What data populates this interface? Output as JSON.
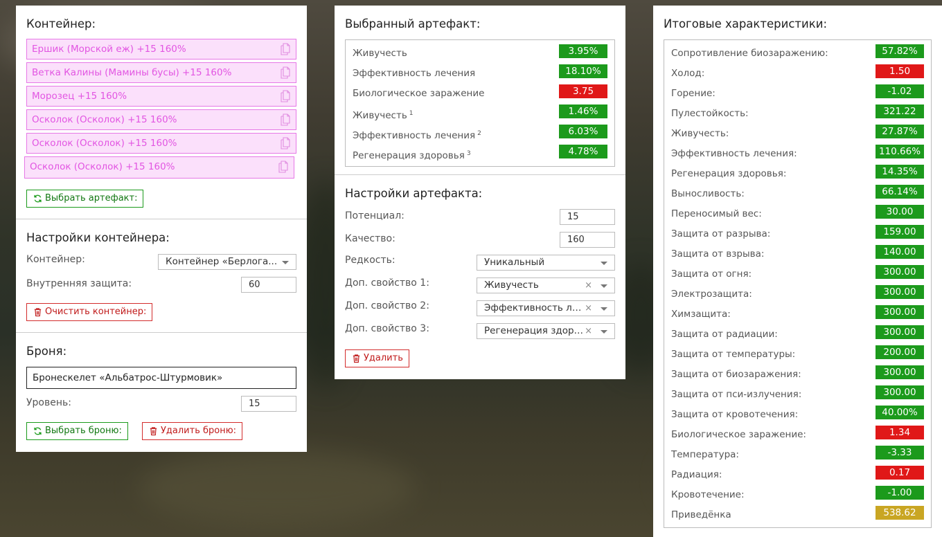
{
  "colors": {
    "green": "#1c9a1c",
    "red": "#e01818",
    "gold": "#c9a623",
    "pink": "#e255e2"
  },
  "container_panel": {
    "title": "Контейнер:",
    "items": [
      "Ершик (Морской еж) +15 160%",
      "Ветка Калины (Мамины бусы) +15 160%",
      "Морозец +15 160%",
      "Осколок (Осколок) +15 160%",
      "Осколок (Осколок) +15 160%",
      "Осколок (Осколок) +15 160%"
    ],
    "item_icon": "copy-document-icon",
    "choose_artifact_button": "Выбрать артефакт:",
    "settings_title": "Настройки контейнера:",
    "container_label": "Контейнер:",
    "container_value": "Контейнер «Берлога...",
    "inner_protection_label": "Внутренняя защита:",
    "inner_protection_value": "60",
    "clear_button": "Очистить контейнер:",
    "armor_title": "Броня:",
    "armor_name": "Бронескелет «Альбатрос-Штурмовик»",
    "level_label": "Уровень:",
    "level_value": "15",
    "choose_armor_button": "Выбрать броню:",
    "delete_armor_button": "Удалить броню:"
  },
  "artifact_panel": {
    "title": "Выбранный артефакт:",
    "stats": [
      {
        "label": "Живучесть",
        "sup": "",
        "value": "3.95%",
        "color": "green"
      },
      {
        "label": "Эффективность лечения",
        "sup": "",
        "value": "18.10%",
        "color": "green"
      },
      {
        "label": "Биологическое заражение",
        "sup": "",
        "value": "3.75",
        "color": "red"
      },
      {
        "label": "Живучесть",
        "sup": "1",
        "value": "1.46%",
        "color": "green"
      },
      {
        "label": "Эффективность лечения",
        "sup": "2",
        "value": "6.03%",
        "color": "green"
      },
      {
        "label": "Регенерация здоровья",
        "sup": "3",
        "value": "4.78%",
        "color": "green"
      }
    ],
    "settings_title": "Настройки артефакта:",
    "potential_label": "Потенциал:",
    "potential_value": "15",
    "quality_label": "Качество:",
    "quality_value": "160",
    "rarity_label": "Редкость:",
    "rarity_value": "Уникальный",
    "prop1_label": "Доп. свойство 1:",
    "prop1_value": "Живучесть",
    "prop2_label": "Доп. свойство 2:",
    "prop2_value": "Эффективность лечения",
    "prop3_label": "Доп. свойство 3:",
    "prop3_value": "Регенерация здоровья",
    "clear_glyph": "×",
    "delete_button": "Удалить"
  },
  "totals_panel": {
    "title": "Итоговые характеристики:",
    "stats": [
      {
        "label": "Сопротивление биозаражению:",
        "value": "57.82%",
        "color": "green"
      },
      {
        "label": "Холод:",
        "value": "1.50",
        "color": "red"
      },
      {
        "label": "Горение:",
        "value": "-1.02",
        "color": "green"
      },
      {
        "label": "Пулестойкость:",
        "value": "321.22",
        "color": "green"
      },
      {
        "label": "Живучесть:",
        "value": "27.87%",
        "color": "green"
      },
      {
        "label": "Эффективность лечения:",
        "value": "110.66%",
        "color": "green"
      },
      {
        "label": "Регенерация здоровья:",
        "value": "14.35%",
        "color": "green"
      },
      {
        "label": "Выносливость:",
        "value": "66.14%",
        "color": "green"
      },
      {
        "label": "Переносимый вес:",
        "value": "30.00",
        "color": "green"
      },
      {
        "label": "Защита от разрыва:",
        "value": "159.00",
        "color": "green"
      },
      {
        "label": "Защита от взрыва:",
        "value": "140.00",
        "color": "green"
      },
      {
        "label": "Защита от огня:",
        "value": "300.00",
        "color": "green"
      },
      {
        "label": "Электрозащита:",
        "value": "300.00",
        "color": "green"
      },
      {
        "label": "Химзащита:",
        "value": "300.00",
        "color": "green"
      },
      {
        "label": "Защита от радиации:",
        "value": "300.00",
        "color": "green"
      },
      {
        "label": "Защита от температуры:",
        "value": "200.00",
        "color": "green"
      },
      {
        "label": "Защита от биозаражения:",
        "value": "300.00",
        "color": "green"
      },
      {
        "label": "Защита от пси-излучения:",
        "value": "300.00",
        "color": "green"
      },
      {
        "label": "Защита от кровотечения:",
        "value": "40.00%",
        "color": "green"
      },
      {
        "label": "Биологическое заражение:",
        "value": "1.34",
        "color": "red"
      },
      {
        "label": "Температура:",
        "value": "-3.33",
        "color": "green"
      },
      {
        "label": "Радиация:",
        "value": "0.17",
        "color": "red"
      },
      {
        "label": "Кровотечение:",
        "value": "-1.00",
        "color": "green"
      },
      {
        "label": "Приведёнка",
        "value": "538.62",
        "color": "gold"
      }
    ]
  }
}
